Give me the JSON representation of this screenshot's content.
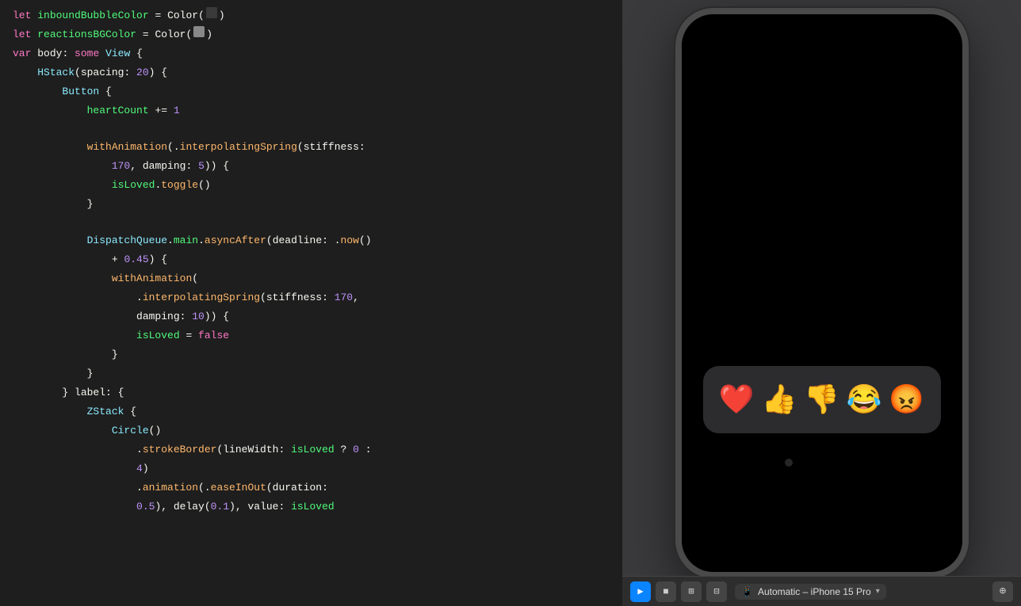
{
  "code": {
    "lines": [
      {
        "tokens": [
          {
            "text": "let ",
            "class": "kw-let"
          },
          {
            "text": "inboundBubbleColor",
            "class": "var-name"
          },
          {
            "text": " = ",
            "class": "plain"
          },
          {
            "text": "Color(",
            "class": "plain"
          },
          {
            "text": "COLOR_BOX_DARK",
            "class": "COLOR_BOX"
          },
          {
            "text": ")",
            "class": "plain"
          }
        ]
      },
      {
        "tokens": [
          {
            "text": "let ",
            "class": "kw-let"
          },
          {
            "text": "reactionsBGColor",
            "class": "var-name"
          },
          {
            "text": " = ",
            "class": "plain"
          },
          {
            "text": "Color(",
            "class": "plain"
          },
          {
            "text": "COLOR_BOX_LIGHT",
            "class": "COLOR_BOX"
          },
          {
            "text": ")",
            "class": "plain"
          }
        ]
      },
      {
        "tokens": [
          {
            "text": "var ",
            "class": "kw-var"
          },
          {
            "text": "body",
            "class": "plain"
          },
          {
            "text": ": ",
            "class": "plain"
          },
          {
            "text": "some ",
            "class": "kw-some"
          },
          {
            "text": "View",
            "class": "type-name"
          },
          {
            "text": " {",
            "class": "plain"
          }
        ]
      },
      {
        "tokens": [
          {
            "text": "    ",
            "class": "plain"
          },
          {
            "text": "HStack",
            "class": "type-name"
          },
          {
            "text": "(spacing: ",
            "class": "plain"
          },
          {
            "text": "20",
            "class": "number"
          },
          {
            "text": ") {",
            "class": "plain"
          }
        ]
      },
      {
        "tokens": [
          {
            "text": "        ",
            "class": "plain"
          },
          {
            "text": "Button",
            "class": "type-name"
          },
          {
            "text": " {",
            "class": "plain"
          }
        ]
      },
      {
        "tokens": [
          {
            "text": "            ",
            "class": "plain"
          },
          {
            "text": "heartCount",
            "class": "var-name"
          },
          {
            "text": " += ",
            "class": "plain"
          },
          {
            "text": "1",
            "class": "number"
          }
        ]
      },
      {
        "tokens": [
          {
            "text": "",
            "class": "plain"
          }
        ]
      },
      {
        "tokens": [
          {
            "text": "            ",
            "class": "plain"
          },
          {
            "text": "withAnimation",
            "class": "method-name"
          },
          {
            "text": "(.",
            "class": "plain"
          },
          {
            "text": "interpolatingSpring",
            "class": "method-name"
          },
          {
            "text": "(stiffness:",
            "class": "plain"
          }
        ]
      },
      {
        "tokens": [
          {
            "text": "                ",
            "class": "plain"
          },
          {
            "text": "170",
            "class": "number"
          },
          {
            "text": ", damping: ",
            "class": "plain"
          },
          {
            "text": "5",
            "class": "number"
          },
          {
            "text": ")) {",
            "class": "plain"
          }
        ]
      },
      {
        "tokens": [
          {
            "text": "                ",
            "class": "plain"
          },
          {
            "text": "isLoved",
            "class": "var-name"
          },
          {
            "text": ".",
            "class": "plain"
          },
          {
            "text": "toggle",
            "class": "method-name"
          },
          {
            "text": "()",
            "class": "plain"
          }
        ]
      },
      {
        "tokens": [
          {
            "text": "            }",
            "class": "plain"
          }
        ]
      },
      {
        "tokens": [
          {
            "text": "",
            "class": "plain"
          }
        ]
      },
      {
        "tokens": [
          {
            "text": "            ",
            "class": "plain"
          },
          {
            "text": "DispatchQueue",
            "class": "type-name"
          },
          {
            "text": ".",
            "class": "plain"
          },
          {
            "text": "main",
            "class": "var-name"
          },
          {
            "text": ".",
            "class": "plain"
          },
          {
            "text": "asyncAfter",
            "class": "method-name"
          },
          {
            "text": "(deadline: .",
            "class": "plain"
          },
          {
            "text": "now",
            "class": "method-name"
          },
          {
            "text": "()",
            "class": "plain"
          }
        ]
      },
      {
        "tokens": [
          {
            "text": "                + ",
            "class": "plain"
          },
          {
            "text": "0.45",
            "class": "number"
          },
          {
            "text": ") {",
            "class": "plain"
          }
        ]
      },
      {
        "tokens": [
          {
            "text": "                ",
            "class": "plain"
          },
          {
            "text": "withAnimation",
            "class": "method-name"
          },
          {
            "text": "(",
            "class": "plain"
          }
        ]
      },
      {
        "tokens": [
          {
            "text": "                    .",
            "class": "plain"
          },
          {
            "text": "interpolatingSpring",
            "class": "method-name"
          },
          {
            "text": "(stiffness: ",
            "class": "plain"
          },
          {
            "text": "170",
            "class": "number"
          },
          {
            "text": ",",
            "class": "plain"
          }
        ]
      },
      {
        "tokens": [
          {
            "text": "                    damping: ",
            "class": "plain"
          },
          {
            "text": "10",
            "class": "number"
          },
          {
            "text": ")) {",
            "class": "plain"
          }
        ]
      },
      {
        "tokens": [
          {
            "text": "                    ",
            "class": "plain"
          },
          {
            "text": "isLoved",
            "class": "var-name"
          },
          {
            "text": " = ",
            "class": "plain"
          },
          {
            "text": "false",
            "class": "kw-false"
          }
        ]
      },
      {
        "tokens": [
          {
            "text": "                }",
            "class": "plain"
          }
        ]
      },
      {
        "tokens": [
          {
            "text": "            }",
            "class": "plain"
          }
        ]
      },
      {
        "tokens": [
          {
            "text": "        } label: {",
            "class": "plain"
          }
        ]
      },
      {
        "tokens": [
          {
            "text": "            ",
            "class": "plain"
          },
          {
            "text": "ZStack",
            "class": "type-name"
          },
          {
            "text": " {",
            "class": "plain"
          }
        ]
      },
      {
        "tokens": [
          {
            "text": "                ",
            "class": "plain"
          },
          {
            "text": "Circle",
            "class": "type-name"
          },
          {
            "text": "()",
            "class": "plain"
          }
        ]
      },
      {
        "tokens": [
          {
            "text": "                    .",
            "class": "plain"
          },
          {
            "text": "strokeBorder",
            "class": "method-name"
          },
          {
            "text": "(lineWidth: ",
            "class": "plain"
          },
          {
            "text": "isLoved",
            "class": "var-name"
          },
          {
            "text": " ? ",
            "class": "plain"
          },
          {
            "text": "0",
            "class": "number"
          },
          {
            "text": " :",
            "class": "plain"
          }
        ]
      },
      {
        "tokens": [
          {
            "text": "                    ",
            "class": "plain"
          },
          {
            "text": "4",
            "class": "number"
          },
          {
            "text": ")",
            "class": "plain"
          }
        ]
      },
      {
        "tokens": [
          {
            "text": "                    .",
            "class": "plain"
          },
          {
            "text": "animation",
            "class": "method-name"
          },
          {
            "text": "(.",
            "class": "plain"
          },
          {
            "text": "easeInOut",
            "class": "method-name"
          },
          {
            "text": "(duration:",
            "class": "plain"
          }
        ]
      },
      {
        "tokens": [
          {
            "text": "                    ",
            "class": "plain"
          },
          {
            "text": "0.5",
            "class": "number"
          },
          {
            "text": "), delay(",
            "class": "plain"
          },
          {
            "text": "0.1",
            "class": "number"
          },
          {
            "text": "), value: ",
            "class": "plain"
          },
          {
            "text": "isLoved",
            "class": "var-name"
          }
        ]
      }
    ]
  },
  "simulator": {
    "device_label": "Automatic – iPhone 15 Pro",
    "emojis": [
      "❤️",
      "👍",
      "👎",
      "😂",
      "😡"
    ]
  },
  "toolbar": {
    "device_selector": "Automatic – iPhone 15 Pro",
    "chevron": "▾",
    "zoom_icon": "⊕"
  }
}
